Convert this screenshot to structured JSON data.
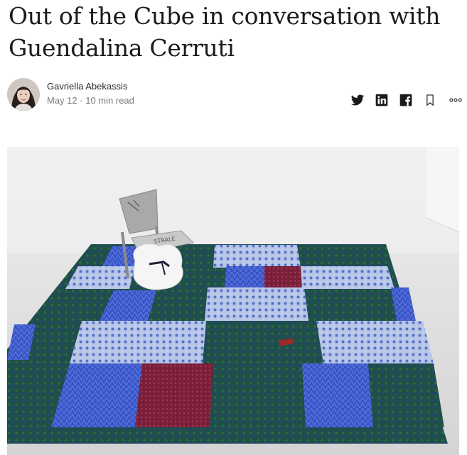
{
  "article": {
    "title": "Out of the Cube in conversation with Guendalina Cerruti",
    "author": "Gavriella Abekassis",
    "date": "May 12",
    "separator": "·",
    "read_time": "10 min read"
  },
  "share": {
    "icons": [
      "twitter-icon",
      "linkedin-icon",
      "facebook-icon",
      "bookmark-icon",
      "more-icon"
    ]
  },
  "hero_image": {
    "description_icon": "artwork-photo",
    "colors": {
      "wall": "#ebebeb",
      "floor": "#dcdcdc",
      "quilt_green": "#1f4f4b",
      "quilt_blue": "#3a55c8",
      "quilt_light": "#9fb2de",
      "quilt_red": "#7a1f3a"
    }
  }
}
